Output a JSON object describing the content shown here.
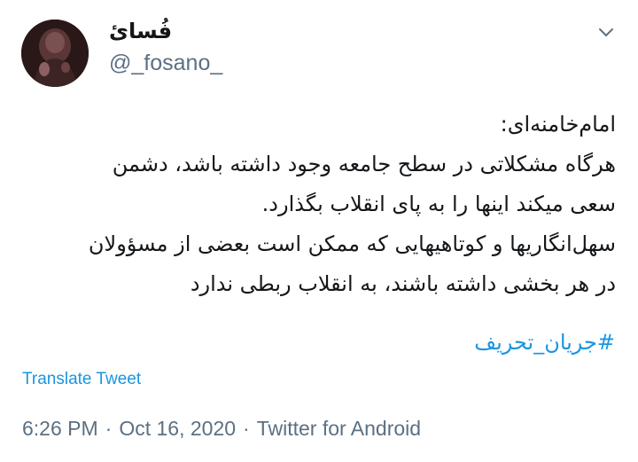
{
  "user": {
    "display_name": "فُسائ",
    "username": "@_fosano_"
  },
  "tweet": {
    "lines": [
      "امام‌خامنه‌ای:",
      "هرگاه مشکلاتی در سطح جامعه وجود داشته باشد، دشمن",
      "سعی میکند اینها را به پای انقلاب بگذارد.",
      "سهل‌انگاریها و کوتاهیهایی که ممکن است بعضی از مسؤولان",
      "در هر بخشی داشته باشند، به انقلاب ربطی ندارد"
    ],
    "hashtag": "#جریان_تحریف",
    "translate_label": "Translate Tweet",
    "time": "6:26 PM",
    "separator": "·",
    "date": "Oct 16, 2020",
    "source": "Twitter for Android"
  },
  "icons": {
    "avatar": "profile-photo",
    "caret": "chevron-down-icon"
  },
  "colors": {
    "link": "#1b95e0",
    "secondary_text": "#5b7083",
    "primary_text": "#14171a"
  }
}
